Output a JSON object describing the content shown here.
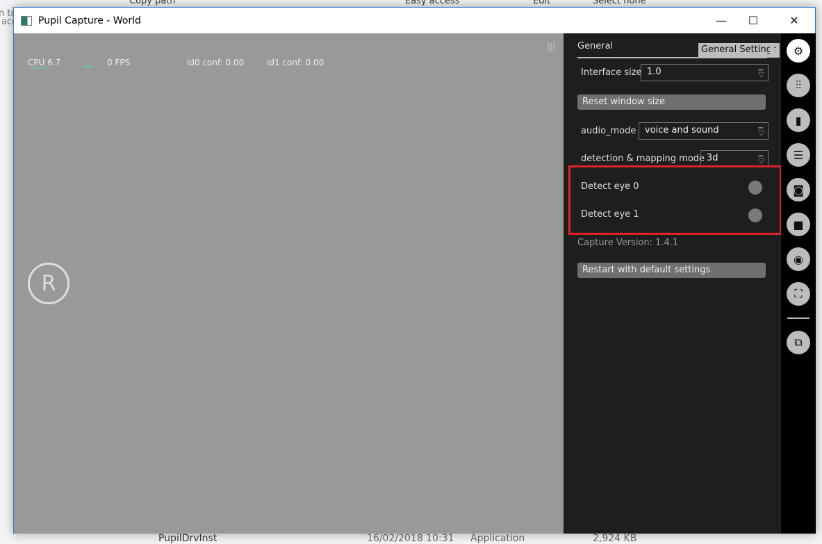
{
  "background": {
    "copy_path": "Copy path",
    "easy_access": "Easy access",
    "edit": "Edit",
    "select_none": "Select none",
    "left1": "n to",
    "left2": "acc",
    "file": {
      "name": "PupilDrvInst",
      "date": "16/02/2018 10:31",
      "type": "Application",
      "size": "2,924 KB"
    }
  },
  "window": {
    "title": "Pupil Capture - World",
    "minimize": "—",
    "maximize": "☐",
    "close": "✕"
  },
  "world": {
    "cpu": "CPU 6.7",
    "fps": "0 FPS",
    "id0": "id0 conf: 0.00",
    "id1": "id1 conf: 0.00",
    "recording_icon": "R"
  },
  "panel": {
    "header": "General",
    "tooltip": "General Settings",
    "interface_size": {
      "label": "Interface size",
      "value": "1.0"
    },
    "reset_button": "Reset window size",
    "audio_mode": {
      "label": "audio_mode",
      "value": "voice and sound"
    },
    "detection_mode": {
      "label": "detection & mapping mode",
      "value": "3d"
    },
    "detect_eye0": {
      "label": "Detect eye 0",
      "on": false
    },
    "detect_eye1": {
      "label": "Detect eye 1",
      "on": false
    },
    "version": "Capture Version: 1.4.1",
    "restart_button": "Restart with default settings",
    "highlight_color": "#e0202a"
  },
  "icons": [
    "gear-icon",
    "sliders-icon",
    "bar-chart-icon",
    "list-icon",
    "camera-icon",
    "video-icon",
    "target-icon",
    "focus-icon",
    "cast-icon"
  ]
}
